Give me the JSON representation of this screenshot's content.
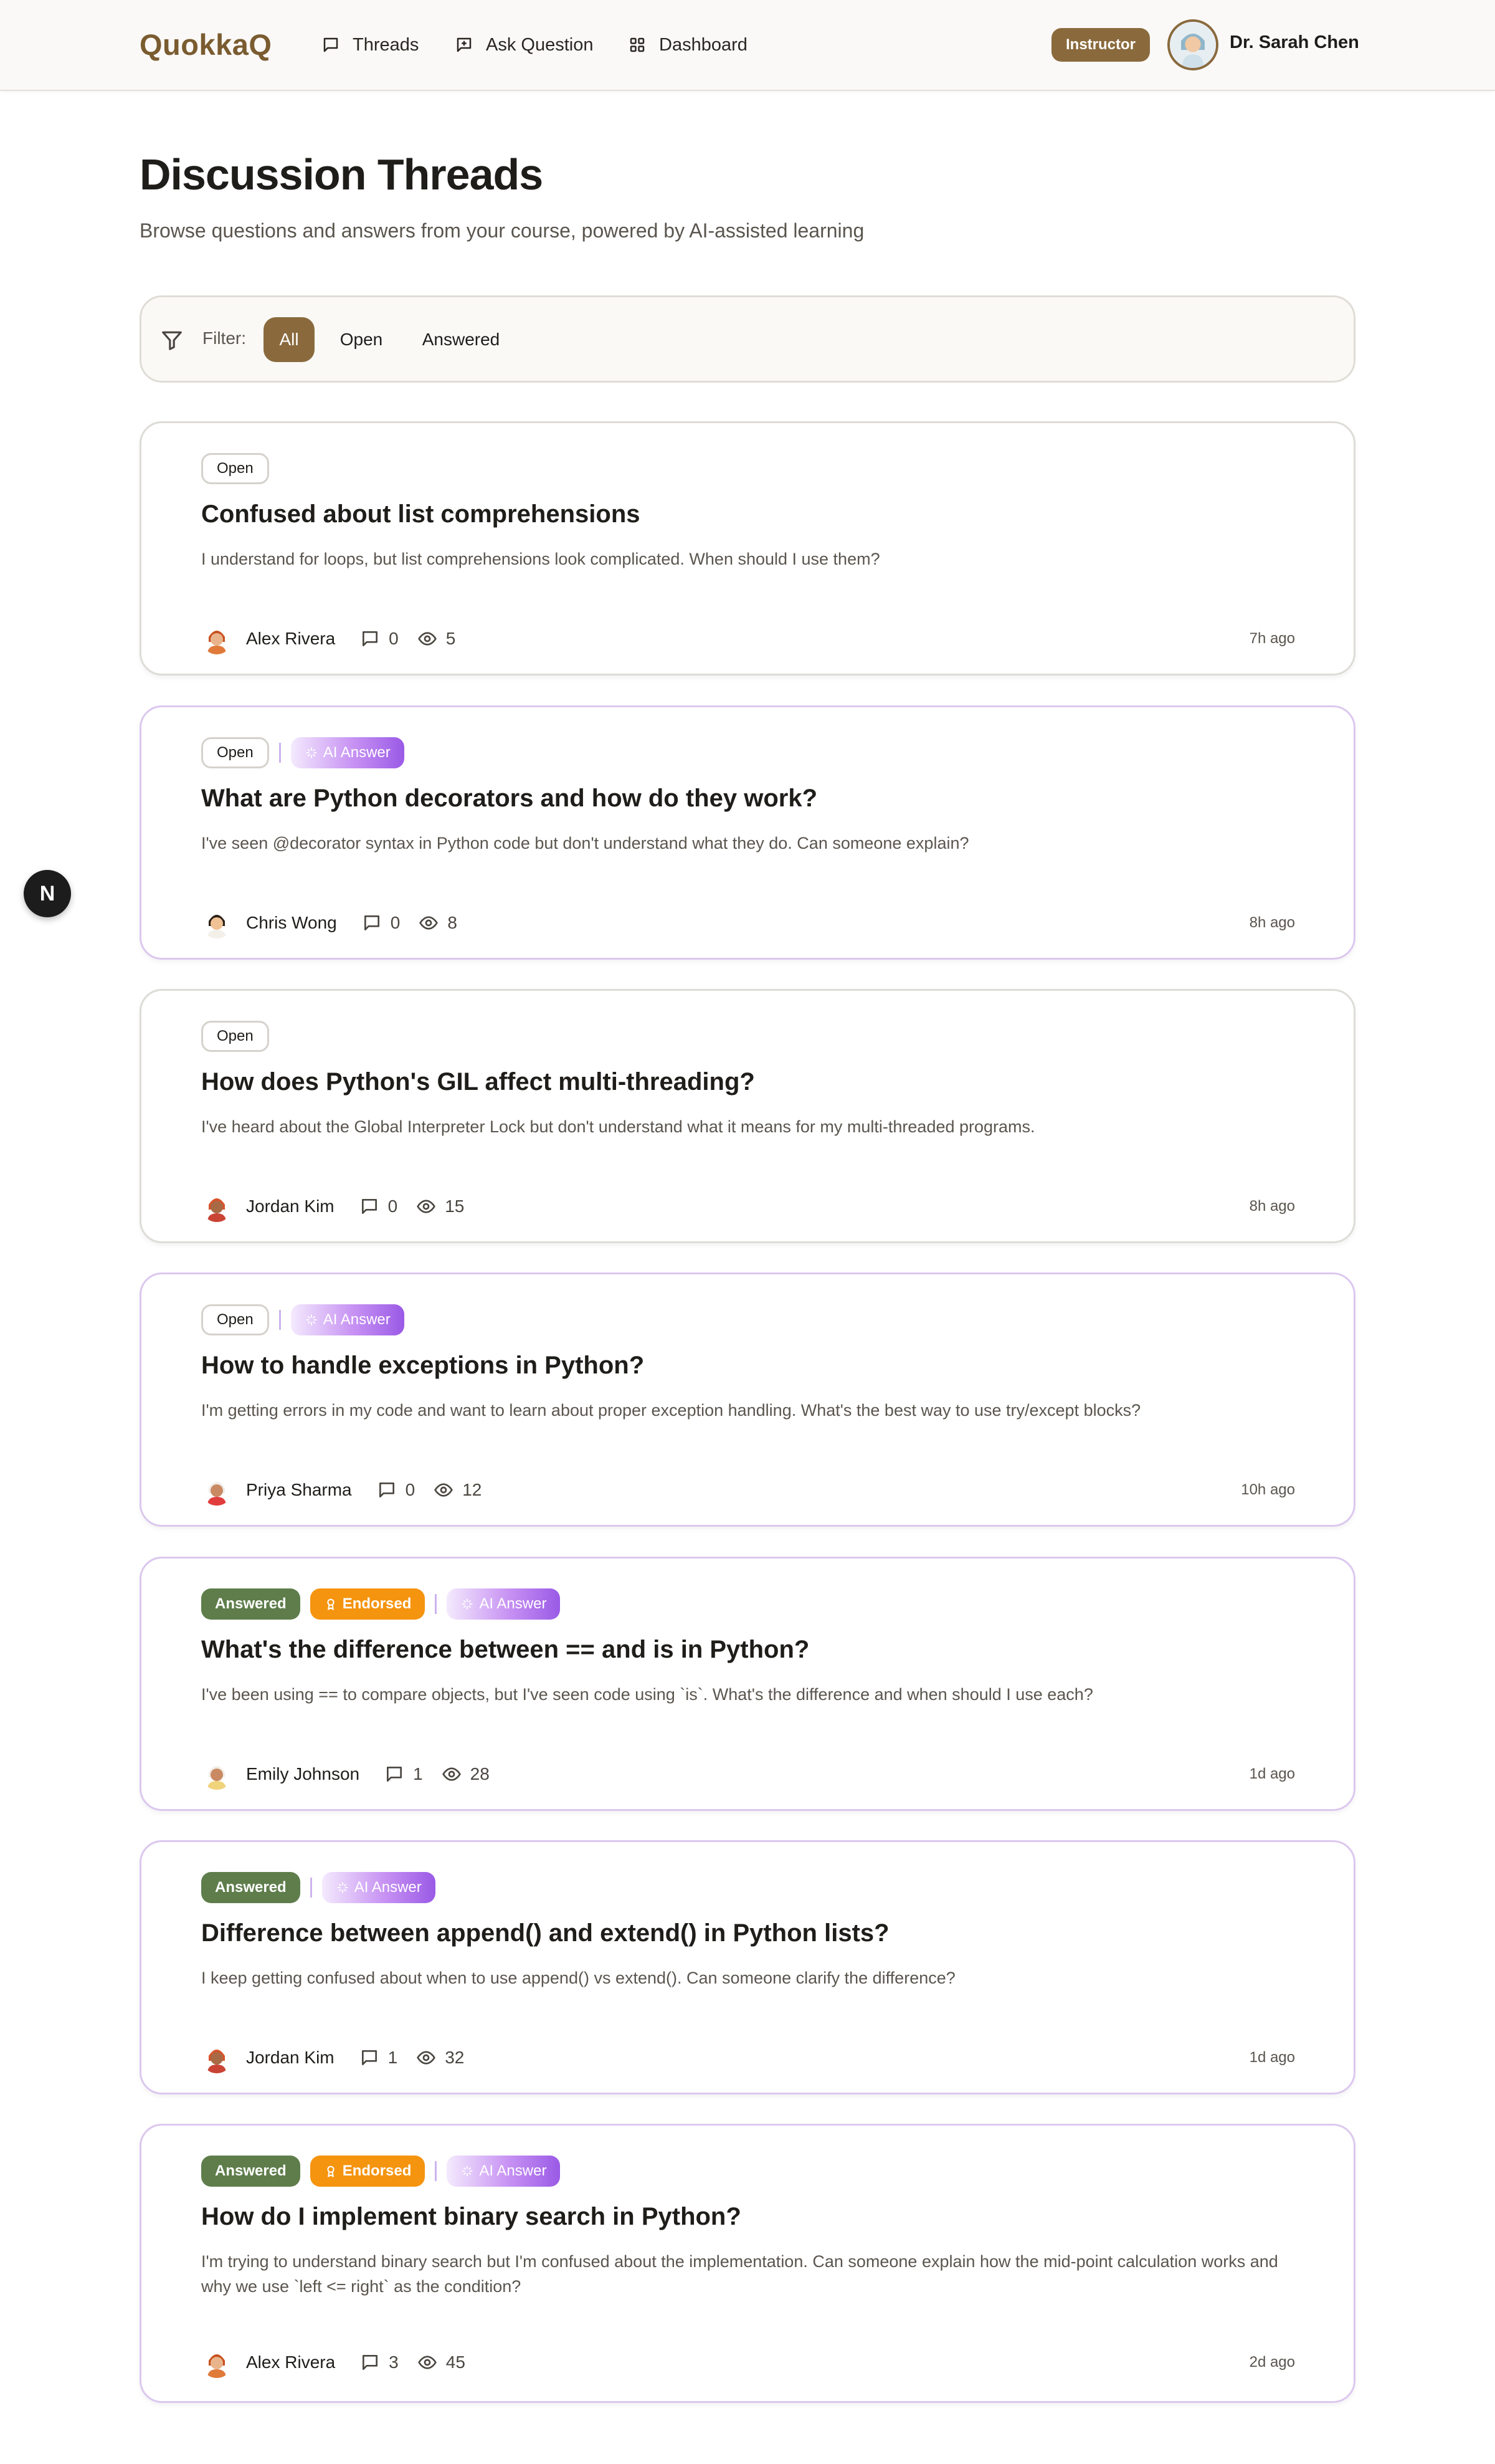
{
  "brand": {
    "name": "QuokkaQ",
    "accent": "#8a6a3d",
    "logo_color": "#7a5c30"
  },
  "nav": {
    "items": [
      {
        "label": "Threads",
        "icon": "message-square-icon"
      },
      {
        "label": "Ask Question",
        "icon": "message-plus-icon"
      },
      {
        "label": "Dashboard",
        "icon": "layout-grid-icon"
      }
    ]
  },
  "user": {
    "role": "Instructor",
    "name": "Dr. Sarah Chen"
  },
  "page": {
    "title": "Discussion Threads",
    "subtitle": "Browse questions and answers from your course, powered by AI-assisted learning"
  },
  "filter": {
    "label": "Filter:",
    "options": [
      "All",
      "Open",
      "Answered"
    ],
    "selected": "All"
  },
  "badges": {
    "open": "Open",
    "answered": "Answered",
    "endorsed": "Endorsed",
    "ai": "AI Answer"
  },
  "threads": [
    {
      "status": "Open",
      "endorsed": false,
      "ai_answer": false,
      "title": "Confused about list comprehensions",
      "excerpt": "I understand for loops, but list comprehensions look complicated. When should I use them?",
      "author": "Alex Rivera",
      "replies": "0",
      "views": "5",
      "time": "7h ago"
    },
    {
      "status": "Open",
      "endorsed": false,
      "ai_answer": true,
      "title": "What are Python decorators and how do they work?",
      "excerpt": "I've seen @decorator syntax in Python code but don't understand what they do. Can someone explain?",
      "author": "Chris Wong",
      "replies": "0",
      "views": "8",
      "time": "8h ago"
    },
    {
      "status": "Open",
      "endorsed": false,
      "ai_answer": false,
      "title": "How does Python's GIL affect multi-threading?",
      "excerpt": "I've heard about the Global Interpreter Lock but don't understand what it means for my multi-threaded programs.",
      "author": "Jordan Kim",
      "replies": "0",
      "views": "15",
      "time": "8h ago"
    },
    {
      "status": "Open",
      "endorsed": false,
      "ai_answer": true,
      "title": "How to handle exceptions in Python?",
      "excerpt": "I'm getting errors in my code and want to learn about proper exception handling. What's the best way to use try/except blocks?",
      "author": "Priya Sharma",
      "replies": "0",
      "views": "12",
      "time": "10h ago"
    },
    {
      "status": "Answered",
      "endorsed": true,
      "ai_answer": true,
      "title": "What's the difference between == and is in Python?",
      "excerpt": "I've been using == to compare objects, but I've seen code using `is`. What's the difference and when should I use each?",
      "author": "Emily Johnson",
      "replies": "1",
      "views": "28",
      "time": "1d ago"
    },
    {
      "status": "Answered",
      "endorsed": false,
      "ai_answer": true,
      "title": "Difference between append() and extend() in Python lists?",
      "excerpt": "I keep getting confused about when to use append() vs extend(). Can someone clarify the difference?",
      "author": "Jordan Kim",
      "replies": "1",
      "views": "32",
      "time": "1d ago"
    },
    {
      "status": "Answered",
      "endorsed": true,
      "ai_answer": true,
      "title": "How do I implement binary search in Python?",
      "excerpt": "I'm trying to understand binary search but I'm confused about the implementation. Can someone explain how the mid-point calculation works and why we use `left <= right` as the condition?",
      "author": "Alex Rivera",
      "replies": "3",
      "views": "45",
      "time": "2d ago"
    }
  ],
  "dev_badge": {
    "label": "N"
  }
}
